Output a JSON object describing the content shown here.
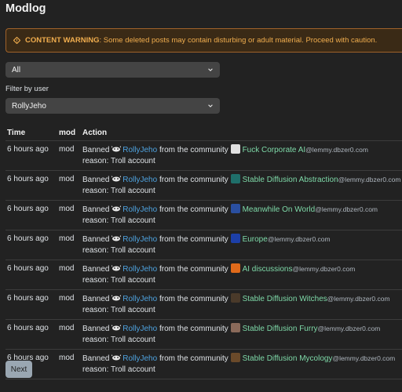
{
  "page": {
    "title": "Modlog"
  },
  "warning": {
    "label": "CONTENT WARNING",
    "text": ": Some deleted posts may contain disturbing or adult material. Proceed with caution."
  },
  "filters": {
    "type_select": "All",
    "user_label": "Filter by user",
    "user_select": "RollyJeho"
  },
  "table": {
    "headers": [
      "Time",
      "mod",
      "Action"
    ],
    "rows": [
      {
        "time": "6 hours ago",
        "mod": "mod",
        "banned": "Banned",
        "user": "RollyJeho",
        "from": "from the community",
        "community": "Fuck Corporate AI",
        "host": "@lemmy.dbzer0.com",
        "reason": "reason: Troll account",
        "icon_color": "#e0e0e0"
      },
      {
        "time": "6 hours ago",
        "mod": "mod",
        "banned": "Banned",
        "user": "RollyJeho",
        "from": "from the community",
        "community": "Stable Diffusion Abstraction",
        "host": "@lemmy.dbzer0.com",
        "reason": "reason: Troll account",
        "icon_color": "#1f6f6a"
      },
      {
        "time": "6 hours ago",
        "mod": "mod",
        "banned": "Banned",
        "user": "RollyJeho",
        "from": "from the community",
        "community": "Meanwhile On World",
        "host": "@lemmy.dbzer0.com",
        "reason": "reason: Troll account",
        "icon_color": "#2a4fa0"
      },
      {
        "time": "6 hours ago",
        "mod": "mod",
        "banned": "Banned",
        "user": "RollyJeho",
        "from": "from the community",
        "community": "Europe",
        "host": "@lemmy.dbzer0.com",
        "reason": "reason: Troll account",
        "icon_color": "#1c3fa8"
      },
      {
        "time": "6 hours ago",
        "mod": "mod",
        "banned": "Banned",
        "user": "RollyJeho",
        "from": "from the community",
        "community": "AI discussions",
        "host": "@lemmy.dbzer0.com",
        "reason": "reason: Troll account",
        "icon_color": "#e06a1a"
      },
      {
        "time": "6 hours ago",
        "mod": "mod",
        "banned": "Banned",
        "user": "RollyJeho",
        "from": "from the community",
        "community": "Stable Diffusion Witches",
        "host": "@lemmy.dbzer0.com",
        "reason": "reason: Troll account",
        "icon_color": "#4a3a2a"
      },
      {
        "time": "6 hours ago",
        "mod": "mod",
        "banned": "Banned",
        "user": "RollyJeho",
        "from": "from the community",
        "community": "Stable Diffusion Furry",
        "host": "@lemmy.dbzer0.com",
        "reason": "reason: Troll account",
        "icon_color": "#8a6a5a"
      },
      {
        "time": "6 hours ago",
        "mod": "mod",
        "banned": "Banned",
        "user": "RollyJeho",
        "from": "from the community",
        "community": "Stable Diffusion Mycology",
        "host": "@lemmy.dbzer0.com",
        "reason": "reason: Troll account",
        "icon_color": "#6a4a2a"
      }
    ]
  },
  "pagination": {
    "next_label": "Next"
  },
  "colors": {
    "background": "#222222",
    "warning": "#f0ad4e",
    "link": "#4fa3e0",
    "community": "#7ed9a8"
  }
}
